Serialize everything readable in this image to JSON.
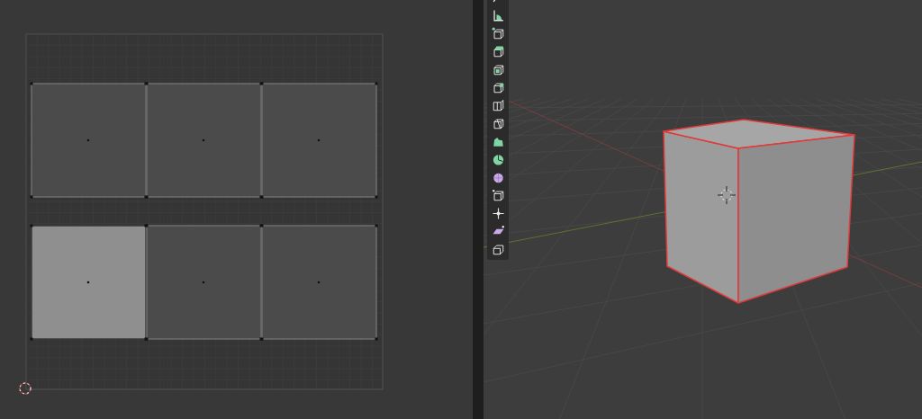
{
  "uv_editor": {
    "faces": [
      {
        "selected": false
      },
      {
        "selected": false
      },
      {
        "selected": false
      },
      {
        "selected": true
      },
      {
        "selected": false
      },
      {
        "selected": false
      }
    ]
  },
  "toolbar": {
    "tools": [
      {
        "kind": "annotate"
      },
      {
        "kind": "measure"
      },
      {
        "kind": "add-cube"
      },
      {
        "kind": "extrude"
      },
      {
        "kind": "inset"
      },
      {
        "kind": "bevel"
      },
      {
        "kind": "loop-cut"
      },
      {
        "kind": "knife"
      },
      {
        "kind": "poly-build"
      },
      {
        "kind": "spin"
      },
      {
        "kind": "smooth"
      },
      {
        "kind": "edge-slide"
      },
      {
        "kind": "shrink"
      },
      {
        "kind": "shear"
      },
      {
        "kind": "rip"
      }
    ]
  },
  "viewport": {
    "object": {
      "selected": true
    }
  }
}
